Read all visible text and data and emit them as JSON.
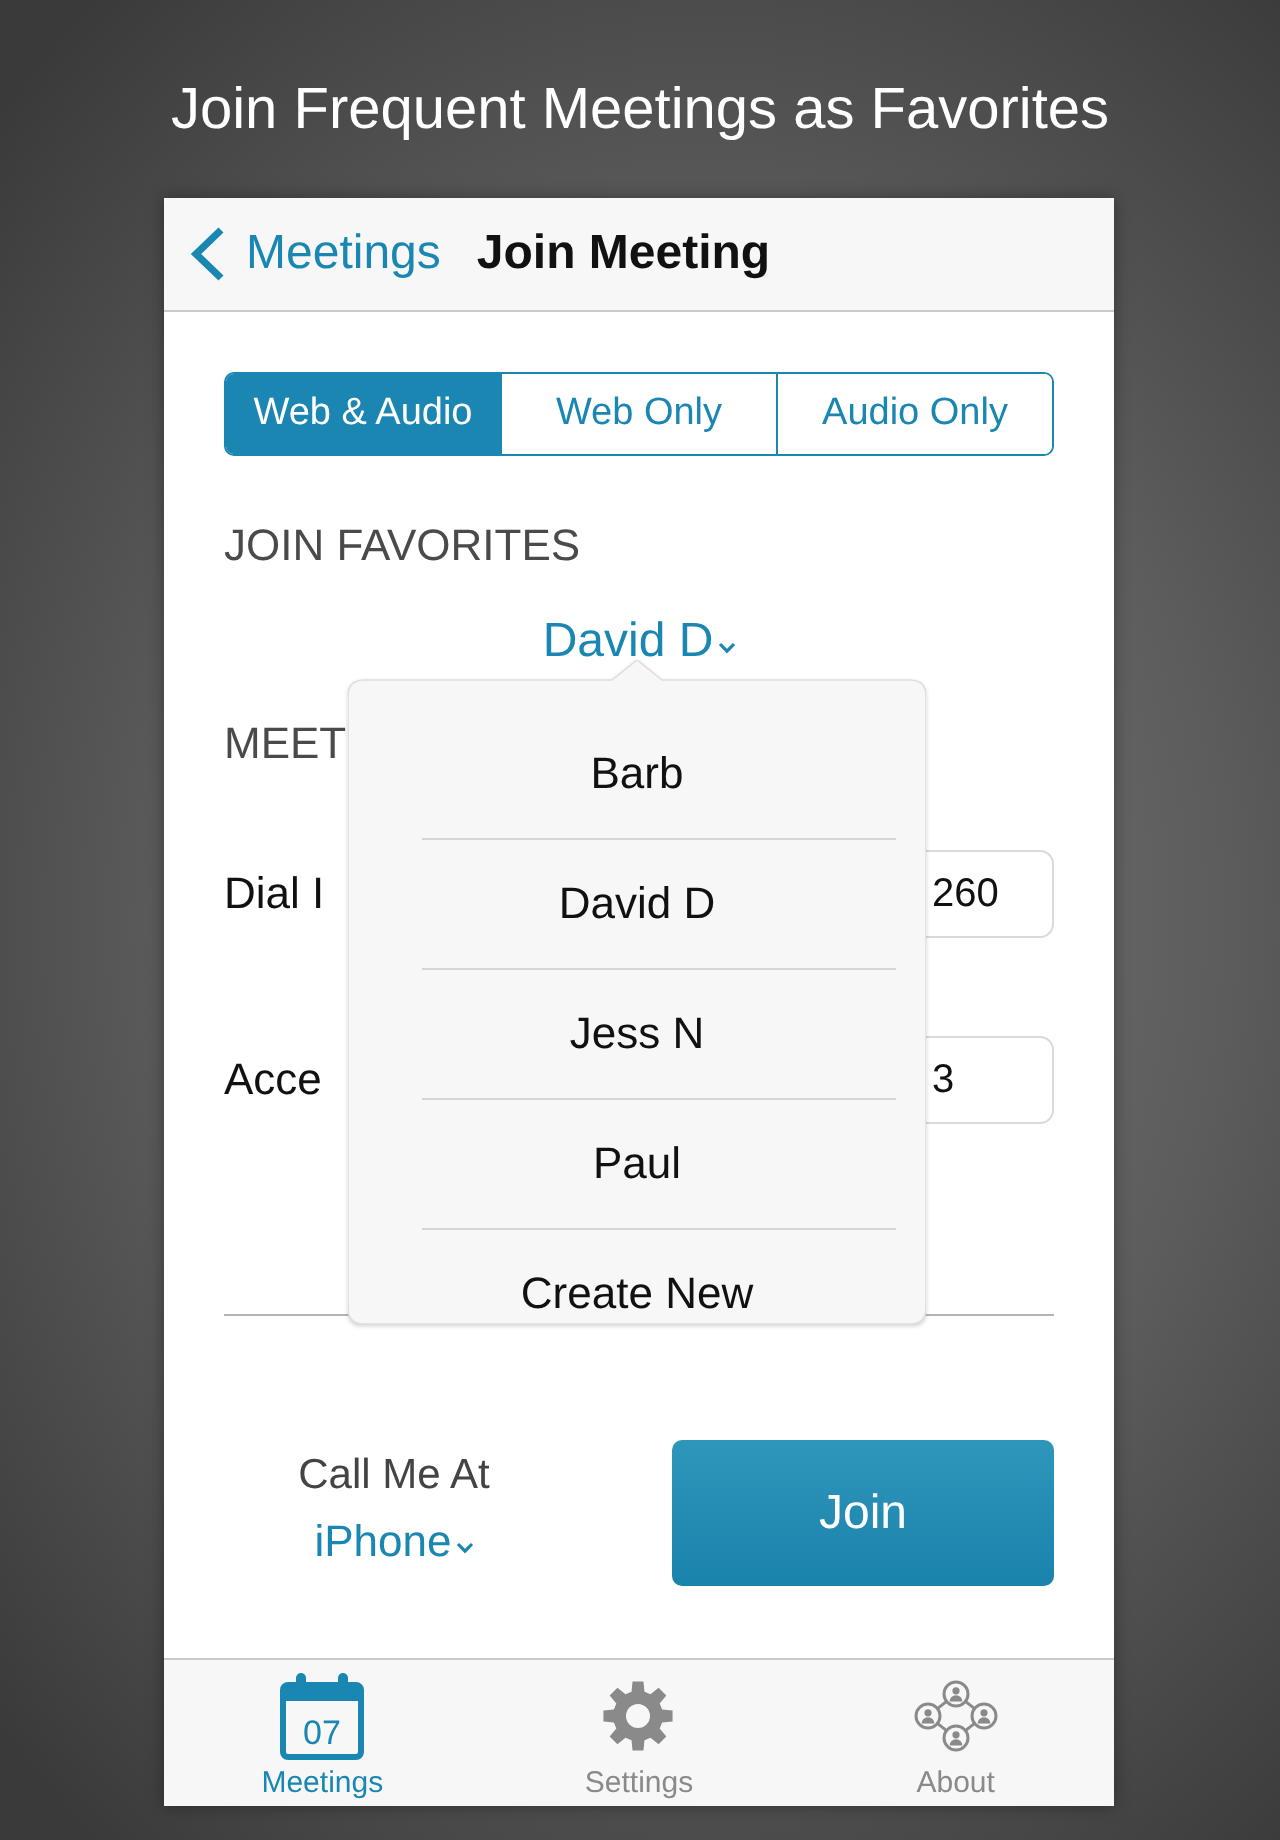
{
  "headline": "Join Frequent Meetings as Favorites",
  "nav_bar": {
    "back_label": "Meetings",
    "title": "Join Meeting"
  },
  "join_mode": [
    {
      "label": "Web & Audio",
      "selected": true
    },
    {
      "label": "Web Only",
      "selected": false
    },
    {
      "label": "Audio Only",
      "selected": false
    }
  ],
  "favorites": {
    "heading": "JOIN FAVORITES",
    "selected_value": "David D",
    "expanded": true,
    "menu_items": [
      "Barb",
      "David D",
      "Jess N",
      "Paul",
      "Create New"
    ]
  },
  "meeting_info": {
    "heading": "MEET",
    "fields": [
      {
        "label": "Dial I",
        "value": "260"
      },
      {
        "label": "Acce",
        "value": "3"
      }
    ]
  },
  "call_me": {
    "label": "Call Me At",
    "value": "iPhone"
  },
  "join_button": "Join",
  "tab_bar": [
    {
      "label": "Meetings",
      "selected": true,
      "icon_text": "07"
    },
    {
      "label": "Settings",
      "selected": false
    },
    {
      "label": "About",
      "selected": false
    }
  ]
}
